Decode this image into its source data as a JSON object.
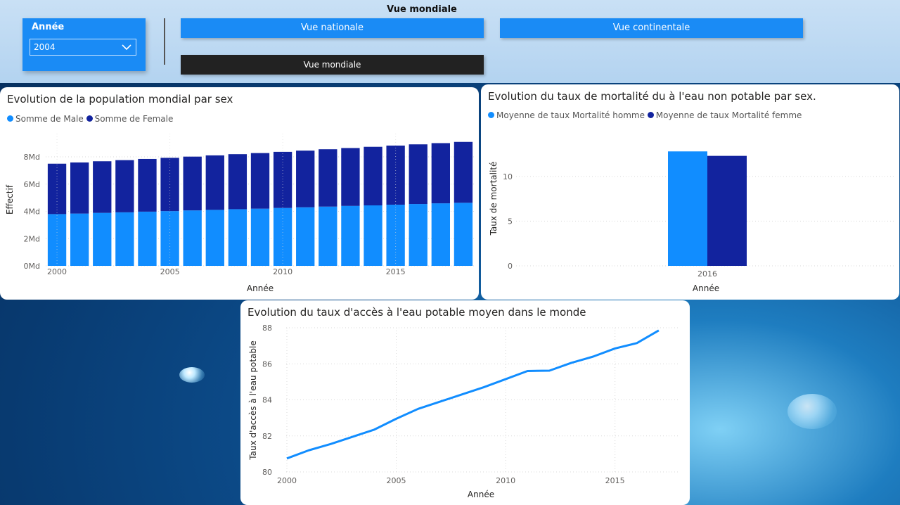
{
  "header": {
    "title": "Vue mondiale",
    "year_slicer": {
      "label": "Année",
      "selected": "2004"
    },
    "buttons": {
      "national": "Vue nationale",
      "continental": "Vue continentale",
      "world": "Vue mondiale"
    }
  },
  "colors": {
    "light_blue": "#118dff",
    "dark_blue": "#12239e",
    "accent_button": "#1a8bf5",
    "active_button": "#222222"
  },
  "charts": {
    "population": {
      "title": "Evolution de la population mondial par sex",
      "legend": [
        "Somme de Male",
        "Somme de Female"
      ],
      "ylabel": "Effectif",
      "xlabel": "Année",
      "yticks": [
        "0Md",
        "2Md",
        "4Md",
        "6Md",
        "8Md"
      ],
      "xticks": [
        "2000",
        "2005",
        "2010",
        "2015"
      ]
    },
    "mortality": {
      "title": "Evolution du taux de mortalité du à l'eau non potable par sex.",
      "legend": [
        "Moyenne de taux  Mortalité homme",
        "Moyenne de taux Mortalité femme"
      ],
      "ylabel": "Taux de mortalité",
      "xlabel": "Année",
      "yticks": [
        "0",
        "5",
        "10"
      ],
      "xticks": [
        "2016"
      ]
    },
    "water_access": {
      "title": "Evolution du taux d'accès à l'eau potable moyen dans le monde",
      "ylabel": "Taux d'accès à l'eau potable",
      "xlabel": "Année",
      "yticks": [
        "80",
        "82",
        "84",
        "86",
        "88"
      ],
      "xticks": [
        "2000",
        "2005",
        "2010",
        "2015"
      ]
    }
  },
  "chart_data": [
    {
      "type": "bar",
      "title": "Evolution de la population mondial par sex",
      "xlabel": "Année",
      "ylabel": "Effectif",
      "categories": [
        2000,
        2001,
        2002,
        2003,
        2004,
        2005,
        2006,
        2007,
        2008,
        2009,
        2010,
        2011,
        2012,
        2013,
        2014,
        2015,
        2016,
        2017,
        2018
      ],
      "ylim": [
        0,
        9.5
      ],
      "stacked": true,
      "series": [
        {
          "name": "Somme de Male",
          "color": "#118dff",
          "values": [
            3.8,
            3.84,
            3.89,
            3.93,
            3.98,
            4.02,
            4.07,
            4.11,
            4.16,
            4.2,
            4.25,
            4.3,
            4.35,
            4.4,
            4.44,
            4.49,
            4.54,
            4.59,
            4.63
          ]
        },
        {
          "name": "Somme de Female",
          "color": "#12239e",
          "values": [
            3.7,
            3.75,
            3.79,
            3.83,
            3.87,
            3.91,
            3.95,
            4.0,
            4.04,
            4.08,
            4.12,
            4.16,
            4.21,
            4.25,
            4.3,
            4.34,
            4.38,
            4.42,
            4.47
          ]
        }
      ]
    },
    {
      "type": "bar",
      "title": "Evolution du taux de mortalité du à l'eau non potable par sex.",
      "xlabel": "Année",
      "ylabel": "Taux de mortalité",
      "categories": [
        2016
      ],
      "ylim": [
        0,
        14
      ],
      "series": [
        {
          "name": "Moyenne de taux  Mortalité homme",
          "color": "#118dff",
          "values": [
            12.8
          ]
        },
        {
          "name": "Moyenne de taux Mortalité femme",
          "color": "#12239e",
          "values": [
            12.3
          ]
        }
      ]
    },
    {
      "type": "line",
      "title": "Evolution du taux d'accès à l'eau potable moyen dans le monde",
      "xlabel": "Année",
      "ylabel": "Taux d'accès à l'eau potable",
      "x": [
        2000,
        2001,
        2002,
        2003,
        2004,
        2005,
        2006,
        2007,
        2008,
        2009,
        2010,
        2011,
        2012,
        2013,
        2014,
        2015,
        2016,
        2017
      ],
      "ylim": [
        80,
        88
      ],
      "series": [
        {
          "color": "#118dff",
          "values": [
            80.75,
            81.2,
            81.55,
            81.95,
            82.35,
            82.95,
            83.5,
            83.9,
            84.3,
            84.7,
            85.15,
            85.6,
            85.62,
            86.05,
            86.4,
            86.85,
            87.15,
            87.85
          ]
        }
      ]
    }
  ]
}
